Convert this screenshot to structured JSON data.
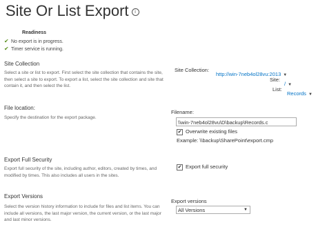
{
  "page": {
    "title": "Site Or List Export",
    "info_icon": "i"
  },
  "readiness": {
    "heading": "Readiness",
    "items": [
      {
        "text": "No export is in progress.",
        "icon": "check-icon"
      },
      {
        "text": "Timer service is running.",
        "icon": "check-icon"
      }
    ]
  },
  "site_collection_section": {
    "title": "Site Collection",
    "description": "Select a site or list to export.  First select the site collection that contains the site, then select a site to export. To export a list, select the site collection and site that contain it, and then select the list.",
    "site_collection_label": "Site Collection:",
    "site_collection_value": "http://win-7neb4ol28vu:2013",
    "site_label": "Site:",
    "site_value": "/",
    "list_label": "List:",
    "list_value": "Records"
  },
  "file_location_section": {
    "title": "File location:",
    "description": "Specify the destination for the export package.",
    "filename_label": "Filename:",
    "filename_value": "\\\\win-7neb4ol28vu\\D\\backup\\Records.c",
    "overwrite_label": "Overwrite existing files",
    "overwrite_checked": true,
    "example_text": "Example: \\\\backup\\SharePoint\\export.cmp"
  },
  "export_security_section": {
    "title": "Export Full Security",
    "description": "Export full security of the site, including author, editors, created by times, and modified by times. This also includes all users in the sites.",
    "checkbox_label": "Export full security",
    "checked": true
  },
  "export_versions_section": {
    "title": "Export Versions",
    "description": "Select the version history information to include for files and list items. You can include all versions, the last major version, the current version, or the last major and last minor versions.",
    "select_label": "Export versions",
    "select_value": "All Versions"
  },
  "colors": {
    "link": "#0072c6",
    "check": "#5a8f1d"
  }
}
